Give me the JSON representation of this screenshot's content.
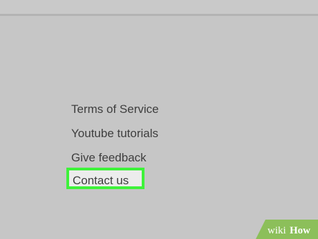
{
  "menu": {
    "items": [
      {
        "label": "Terms of Service"
      },
      {
        "label": "Youtube tutorials"
      },
      {
        "label": "Give feedback"
      },
      {
        "label": "Contact us"
      }
    ]
  },
  "watermark": {
    "prefix": "wiki",
    "suffix": "How"
  },
  "colors": {
    "background": "#c6c6c6",
    "highlight_border": "#3ef23a",
    "highlight_fill": "#ececec",
    "text": "#3e3e3e",
    "watermark_green": "#8cbf5a"
  }
}
